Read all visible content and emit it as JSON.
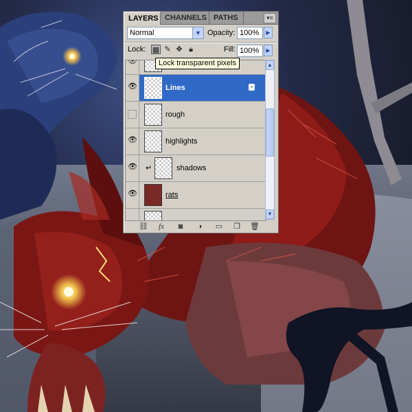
{
  "panel": {
    "tabs": [
      {
        "label": "LAYERS",
        "active": true
      },
      {
        "label": "CHANNELS",
        "active": false
      },
      {
        "label": "PATHS",
        "active": false
      }
    ],
    "menu_icon": "panel-menu-icon",
    "blend_mode": "Normal",
    "opacity_label": "Opacity:",
    "opacity_value": "100%",
    "lock_label": "Lock:",
    "fill_label": "Fill:",
    "fill_value": "100%",
    "tooltip": "Lock transparent pixels",
    "layers": [
      {
        "name": "",
        "visible": true,
        "selected": false,
        "thumbnail": "sketch"
      },
      {
        "name": "Lines",
        "visible": true,
        "selected": true,
        "thumbnail": "sketch",
        "locked": true
      },
      {
        "name": "rough",
        "visible": false,
        "selected": false,
        "thumbnail": "transparent"
      },
      {
        "name": "highlights",
        "visible": true,
        "selected": false,
        "thumbnail": "transparent"
      },
      {
        "name": "shadows",
        "visible": true,
        "selected": false,
        "thumbnail": "sketch",
        "clipped": true
      },
      {
        "name": "rats",
        "visible": true,
        "selected": false,
        "thumbnail": "painting"
      },
      {
        "name": "",
        "visible": false,
        "selected": false,
        "thumbnail": "transparent"
      }
    ],
    "bottom_icons": [
      "link-icon",
      "fx-icon",
      "mask-icon",
      "adjustment-icon",
      "folder-icon",
      "new-layer-icon",
      "trash-icon"
    ]
  },
  "colors": {
    "selection": "#3169c6",
    "panel_bg": "#d4d0c8",
    "tooltip_bg": "#ffffe1"
  }
}
